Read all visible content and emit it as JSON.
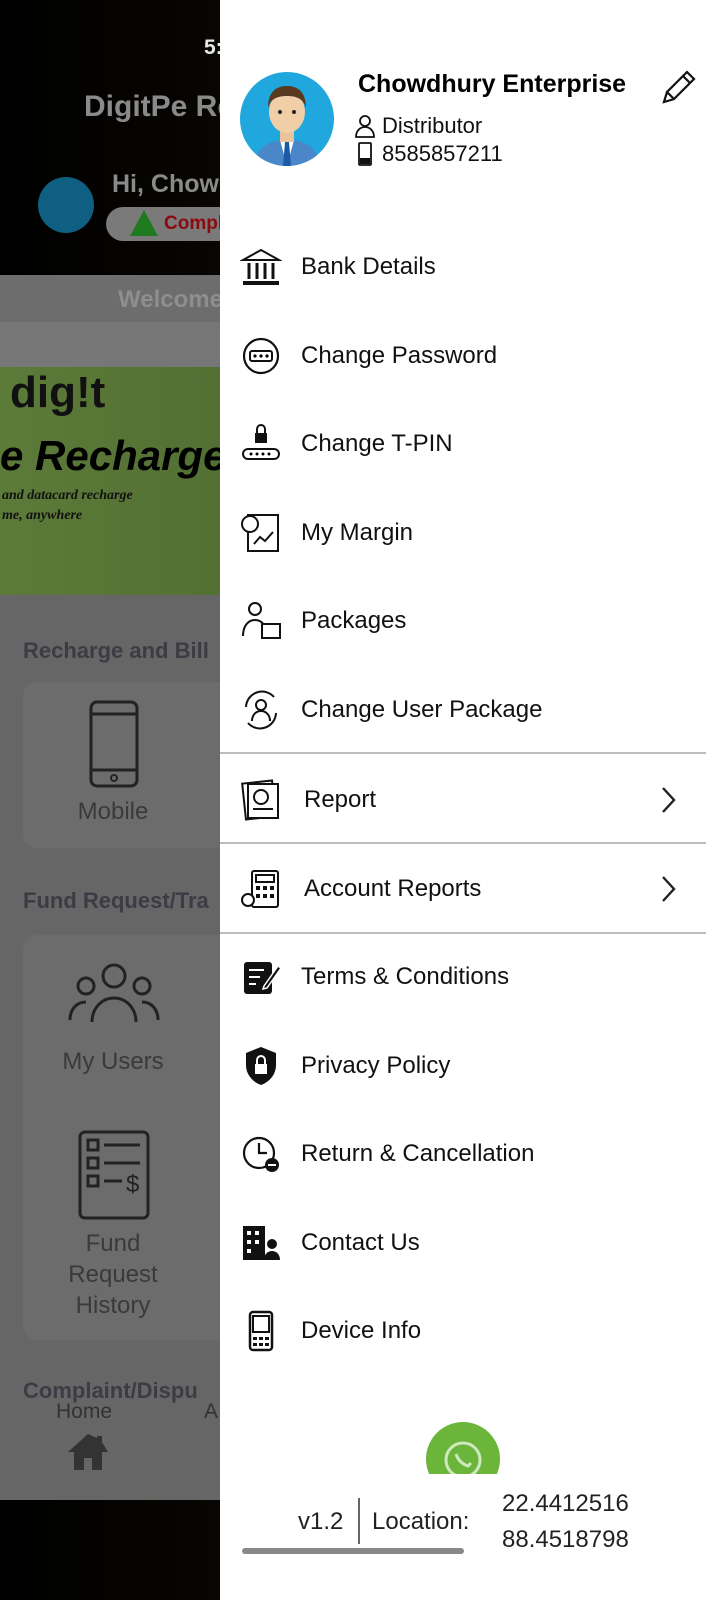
{
  "background": {
    "status_time": "5:",
    "app_title": "DigitPe Re",
    "greeting": "Hi, Chowd",
    "kyc_badge": "Compl",
    "welcome": "Welcome",
    "banner": {
      "brand": "dig!t",
      "headline": "e Recharge",
      "line1": "and datacard  recharge",
      "line2": "me, anywhere"
    },
    "sections": [
      {
        "title": "Recharge and Bill",
        "items": [
          "Mobile"
        ]
      },
      {
        "title": "Fund Request/Tra",
        "items": [
          "My Users",
          "Fund Request History"
        ]
      },
      {
        "title": "Complaint/Dispu"
      }
    ],
    "bottom_nav": [
      "Home",
      "A"
    ]
  },
  "drawer": {
    "profile": {
      "name": "Chowdhury Enterprise",
      "role": "Distributor",
      "phone": "8585857211"
    },
    "items": [
      {
        "label": "Bank Details",
        "icon": "bank-icon"
      },
      {
        "label": "Change Password",
        "icon": "password-icon"
      },
      {
        "label": "Change T-PIN",
        "icon": "lock-pin-icon"
      },
      {
        "label": "My Margin",
        "icon": "margin-chart-icon"
      },
      {
        "label": "Packages",
        "icon": "package-user-icon"
      },
      {
        "label": "Change User Package",
        "icon": "user-swap-icon"
      },
      {
        "label": "Report",
        "icon": "report-icon",
        "expandable": true
      },
      {
        "label": "Account Reports",
        "icon": "calculator-icon",
        "expandable": true
      },
      {
        "label": "Terms & Conditions",
        "icon": "document-edit-icon"
      },
      {
        "label": "Privacy Policy",
        "icon": "shield-lock-icon"
      },
      {
        "label": "Return & Cancellation",
        "icon": "clock-minus-icon"
      },
      {
        "label": "Contact Us",
        "icon": "building-contact-icon"
      },
      {
        "label": "Device Info",
        "icon": "phone-device-icon"
      }
    ],
    "footer": {
      "version": "v1.2",
      "location_label": "Location:",
      "latitude": "22.4412516",
      "longitude": "88.4518798"
    }
  },
  "colors": {
    "whatsapp": "#6bb53a",
    "avatar_bg": "#1fa7de"
  }
}
